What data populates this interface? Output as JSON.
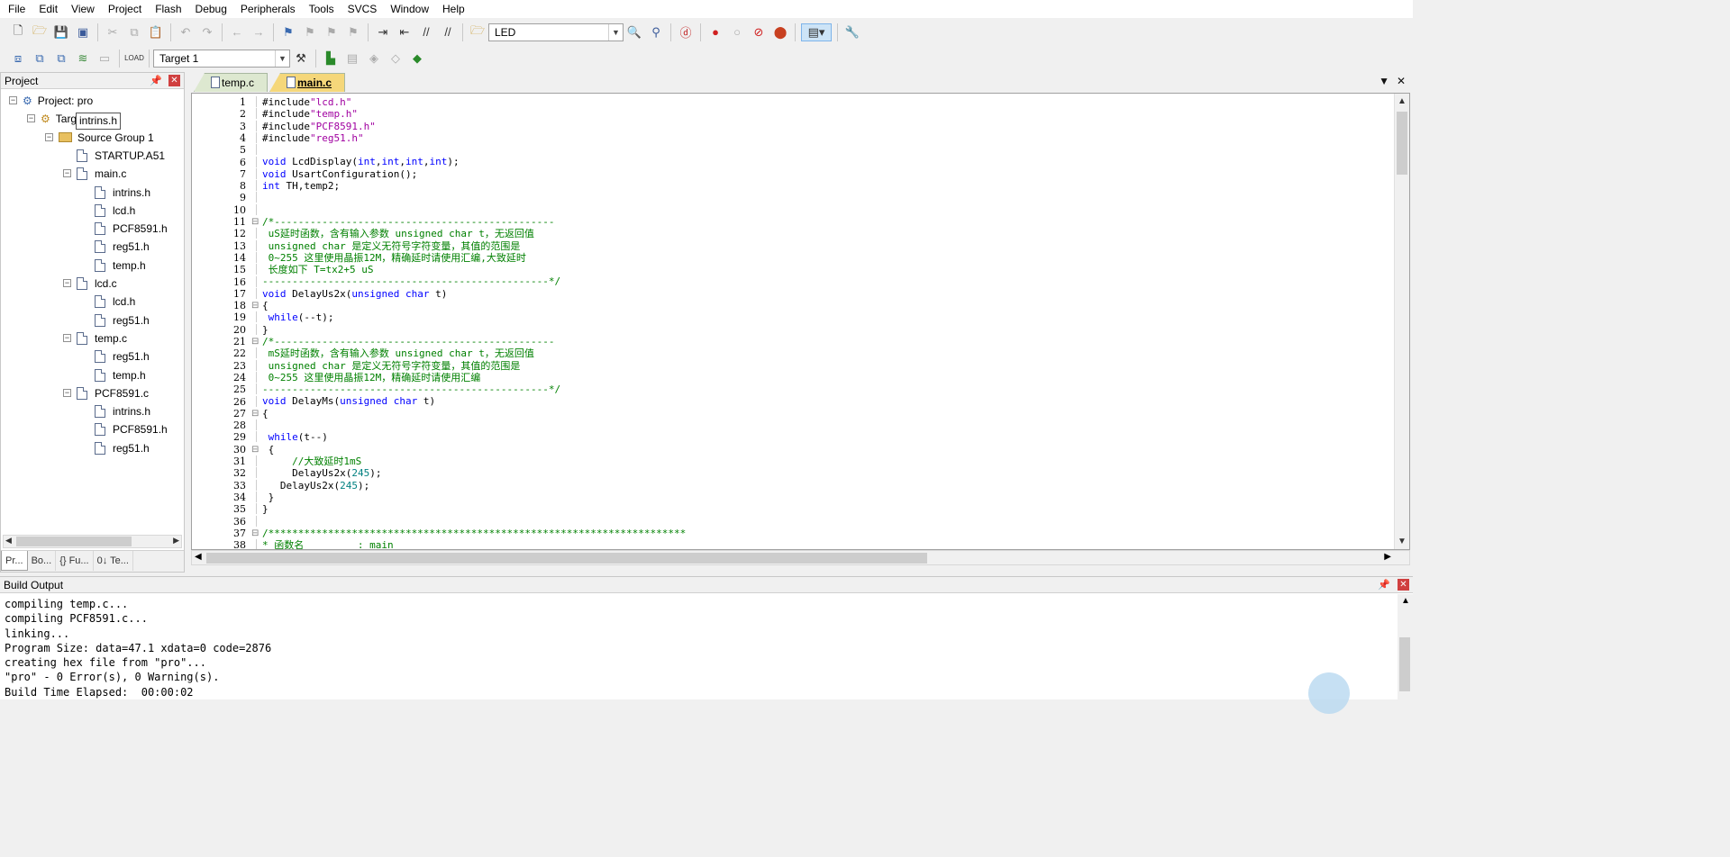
{
  "menu": [
    "File",
    "Edit",
    "View",
    "Project",
    "Flash",
    "Debug",
    "Peripherals",
    "Tools",
    "SVCS",
    "Window",
    "Help"
  ],
  "toolbar": {
    "find_combo_value": "LED",
    "target_combo_value": "Target 1"
  },
  "project_panel": {
    "title": "Project",
    "tree": [
      {
        "label": "Project: pro",
        "level": 0,
        "kind": "project",
        "expanded": true
      },
      {
        "label": "Target 1",
        "level": 1,
        "kind": "target",
        "expanded": true
      },
      {
        "label": "Source Group 1",
        "level": 2,
        "kind": "folder",
        "expanded": true
      },
      {
        "label": "STARTUP.A51",
        "level": 3,
        "kind": "file"
      },
      {
        "label": "main.c",
        "level": 3,
        "kind": "file",
        "expanded": true
      },
      {
        "label": "intrins.h",
        "level": 4,
        "kind": "file"
      },
      {
        "label": "lcd.h",
        "level": 4,
        "kind": "file"
      },
      {
        "label": "PCF8591.h",
        "level": 4,
        "kind": "file"
      },
      {
        "label": "reg51.h",
        "level": 4,
        "kind": "file"
      },
      {
        "label": "temp.h",
        "level": 4,
        "kind": "file"
      },
      {
        "label": "lcd.c",
        "level": 3,
        "kind": "file",
        "expanded": true
      },
      {
        "label": "lcd.h",
        "level": 4,
        "kind": "file"
      },
      {
        "label": "reg51.h",
        "level": 4,
        "kind": "file"
      },
      {
        "label": "temp.c",
        "level": 3,
        "kind": "file",
        "expanded": true
      },
      {
        "label": "reg51.h",
        "level": 4,
        "kind": "file"
      },
      {
        "label": "temp.h",
        "level": 4,
        "kind": "file"
      },
      {
        "label": "PCF8591.c",
        "level": 3,
        "kind": "file",
        "expanded": true
      },
      {
        "label": "intrins.h",
        "level": 4,
        "kind": "file"
      },
      {
        "label": "PCF8591.h",
        "level": 4,
        "kind": "file"
      },
      {
        "label": "reg51.h",
        "level": 4,
        "kind": "file"
      }
    ],
    "tooltip": "intrins.h",
    "bottom_tabs": [
      "Pr...",
      "Bo...",
      "{} Fu...",
      "0↓ Te..."
    ]
  },
  "editor": {
    "tabs": [
      {
        "label": "temp.c",
        "active": false
      },
      {
        "label": "main.c",
        "active": true
      }
    ],
    "lines": [
      {
        "n": "1",
        "fold": "",
        "text": "#include\"lcd.h\""
      },
      {
        "n": "2",
        "fold": "",
        "text": "#include\"temp.h\""
      },
      {
        "n": "3",
        "fold": "",
        "text": "#include\"PCF8591.h\""
      },
      {
        "n": "4",
        "fold": "",
        "text": "#include\"reg51.h\""
      },
      {
        "n": "5",
        "fold": "",
        "text": ""
      },
      {
        "n": "6",
        "fold": "",
        "text": "void LcdDisplay(int,int,int,int);"
      },
      {
        "n": "7",
        "fold": "",
        "text": "void UsartConfiguration();"
      },
      {
        "n": "8",
        "fold": "",
        "text": "int TH,temp2;"
      },
      {
        "n": "9",
        "fold": "",
        "text": ""
      },
      {
        "n": "10",
        "fold": "",
        "text": ""
      },
      {
        "n": "11",
        "fold": "⊟",
        "text": "/*-----------------------------------------------"
      },
      {
        "n": "12",
        "fold": "",
        "text": " uS延时函数，含有输入参数 unsigned char t，无返回值"
      },
      {
        "n": "13",
        "fold": "",
        "text": " unsigned char 是定义无符号字符变量，其值的范围是"
      },
      {
        "n": "14",
        "fold": "",
        "text": " 0~255 这里使用晶振12M，精确延时请使用汇编,大致延时"
      },
      {
        "n": "15",
        "fold": "",
        "text": " 长度如下 T=tx2+5 uS"
      },
      {
        "n": "16",
        "fold": "",
        "text": "------------------------------------------------*/"
      },
      {
        "n": "17",
        "fold": "",
        "text": "void DelayUs2x(unsigned char t)"
      },
      {
        "n": "18",
        "fold": "⊟",
        "text": "{"
      },
      {
        "n": "19",
        "fold": "",
        "text": " while(--t);"
      },
      {
        "n": "20",
        "fold": "",
        "text": "}"
      },
      {
        "n": "21",
        "fold": "⊟",
        "text": "/*-----------------------------------------------"
      },
      {
        "n": "22",
        "fold": "",
        "text": " mS延时函数，含有输入参数 unsigned char t，无返回值"
      },
      {
        "n": "23",
        "fold": "",
        "text": " unsigned char 是定义无符号字符变量，其值的范围是"
      },
      {
        "n": "24",
        "fold": "",
        "text": " 0~255 这里使用晶振12M，精确延时请使用汇编"
      },
      {
        "n": "25",
        "fold": "",
        "text": "------------------------------------------------*/"
      },
      {
        "n": "26",
        "fold": "",
        "text": "void DelayMs(unsigned char t)"
      },
      {
        "n": "27",
        "fold": "⊟",
        "text": "{"
      },
      {
        "n": "28",
        "fold": "",
        "text": ""
      },
      {
        "n": "29",
        "fold": "",
        "text": " while(t--)"
      },
      {
        "n": "30",
        "fold": "⊟",
        "text": " {"
      },
      {
        "n": "31",
        "fold": "",
        "text": "     //大致延时1mS"
      },
      {
        "n": "32",
        "fold": "",
        "text": "     DelayUs2x(245);"
      },
      {
        "n": "33",
        "fold": "",
        "text": "   DelayUs2x(245);"
      },
      {
        "n": "34",
        "fold": "",
        "text": " }"
      },
      {
        "n": "35",
        "fold": "",
        "text": "}"
      },
      {
        "n": "36",
        "fold": "",
        "text": ""
      },
      {
        "n": "37",
        "fold": "⊟",
        "text": "/**********************************************************************"
      },
      {
        "n": "38",
        "fold": "",
        "text": "* 函数名         : main"
      }
    ]
  },
  "build_output": {
    "title": "Build Output",
    "lines": [
      "compiling temp.c...",
      "compiling PCF8591.c...",
      "linking...",
      "Program Size: data=47.1 xdata=0 code=2876",
      "creating hex file from \"pro\"...",
      "\"pro\" - 0 Error(s), 0 Warning(s).",
      "Build Time Elapsed:  00:00:02"
    ]
  }
}
